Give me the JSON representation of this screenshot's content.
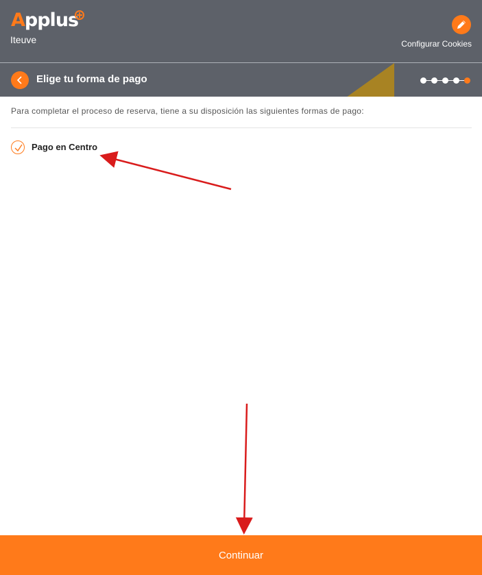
{
  "brand": {
    "logo_first": "A",
    "logo_rest": "pplus",
    "subbrand": "Iteuve",
    "accent_color": "#ff7a1a",
    "header_color": "#5d6169"
  },
  "header": {
    "cookie_label": "Configurar Cookies",
    "cookie_icon": "pencil-icon"
  },
  "step": {
    "title": "Elige tu forma de pago",
    "back_icon": "chevron-left-icon",
    "total_steps": 5,
    "current_step": 5
  },
  "main": {
    "intro": "Para completar el proceso de reserva, tiene a su disposición las siguientes formas de pago:",
    "options": [
      {
        "label": "Pago en Centro",
        "selected": true
      }
    ]
  },
  "footer": {
    "continue_label": "Continuar"
  }
}
